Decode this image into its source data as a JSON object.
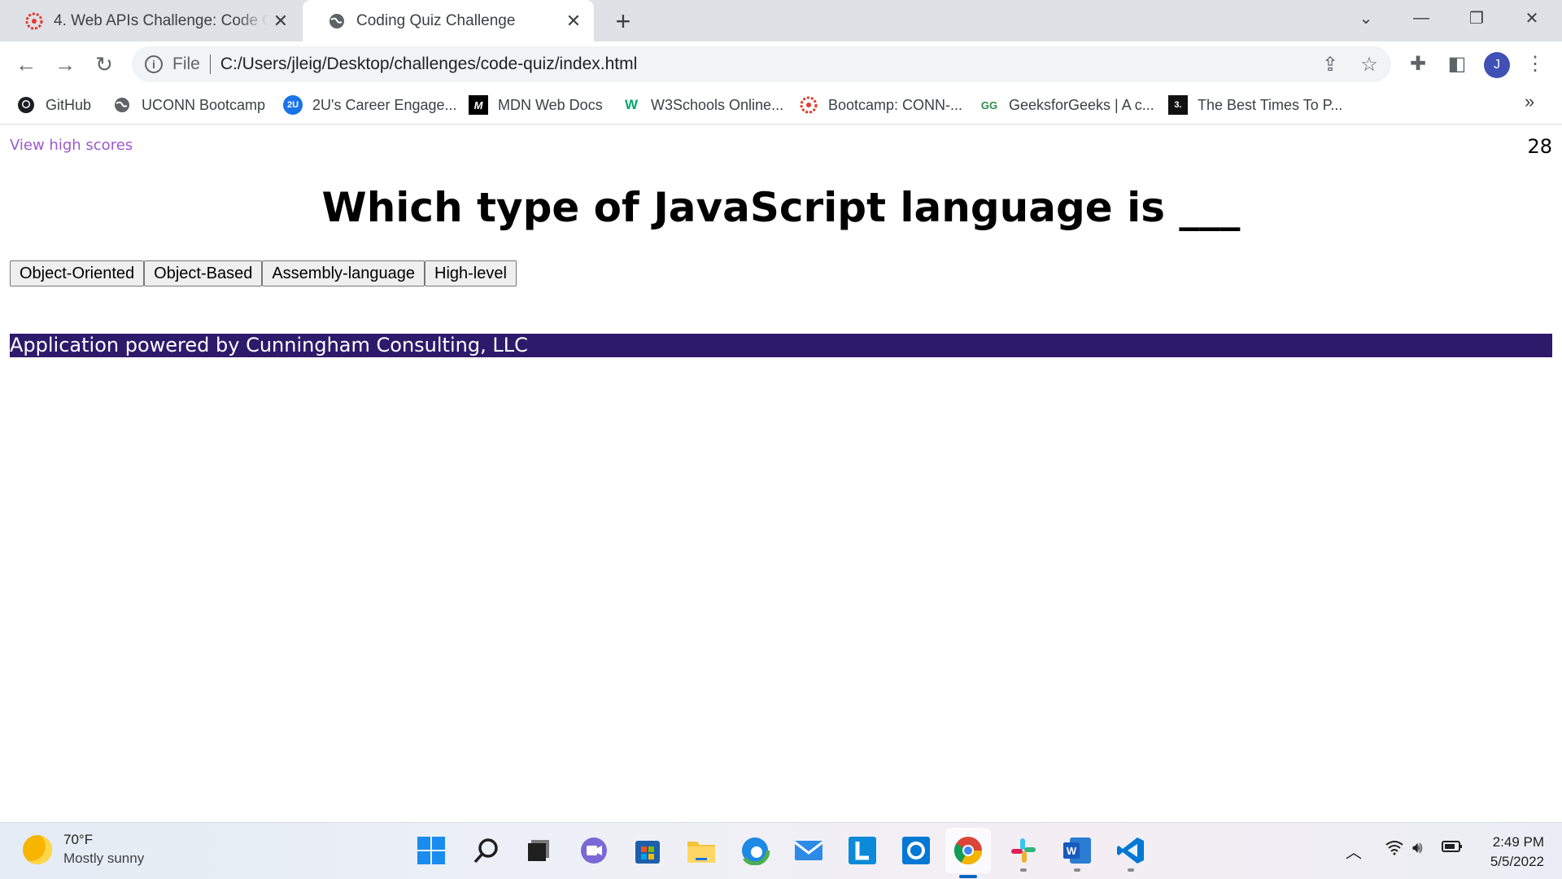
{
  "browser": {
    "tabs": [
      {
        "title": "4. Web APIs Challenge: Code Quiz",
        "active": false,
        "icon": "canvas-icon"
      },
      {
        "title": "Coding Quiz Challenge",
        "active": true,
        "icon": "globe-icon"
      }
    ],
    "address": {
      "scheme_label": "File",
      "url": "C:/Users/jleig/Desktop/challenges/code-quiz/index.html"
    },
    "profile_initial": "J",
    "bookmarks": [
      {
        "label": "GitHub",
        "icon": "github-icon"
      },
      {
        "label": "UCONN Bootcamp",
        "icon": "globe-icon"
      },
      {
        "label": "2U's Career Engage...",
        "icon": "2u-icon",
        "icon_text": "2U"
      },
      {
        "label": "MDN Web Docs",
        "icon": "mdn-icon",
        "icon_text": "M"
      },
      {
        "label": "W3Schools Online...",
        "icon": "w3schools-icon",
        "icon_text": "W"
      },
      {
        "label": "Bootcamp: CONN-...",
        "icon": "canvas-icon"
      },
      {
        "label": "GeeksforGeeks | A c...",
        "icon": "geeksforgeeks-icon",
        "icon_text": "GG"
      },
      {
        "label": "The Best Times To P...",
        "icon": "article-icon",
        "icon_text": "3."
      }
    ],
    "more_bookmarks": "»"
  },
  "quiz": {
    "high_scores_label": "View high scores",
    "timer": "28",
    "question": "Which type of JavaScript language is ___",
    "answers": [
      "Object-Oriented",
      "Object-Based",
      "Assembly-language",
      "High-level"
    ],
    "footer": "Application powered by Cunningham Consulting, LLC",
    "footer_color": "#2e1a6b",
    "link_color": "#9b59d0"
  },
  "taskbar": {
    "weather_temp": "70°F",
    "weather_condition": "Mostly sunny",
    "time": "2:49 PM",
    "date": "5/5/2022"
  }
}
